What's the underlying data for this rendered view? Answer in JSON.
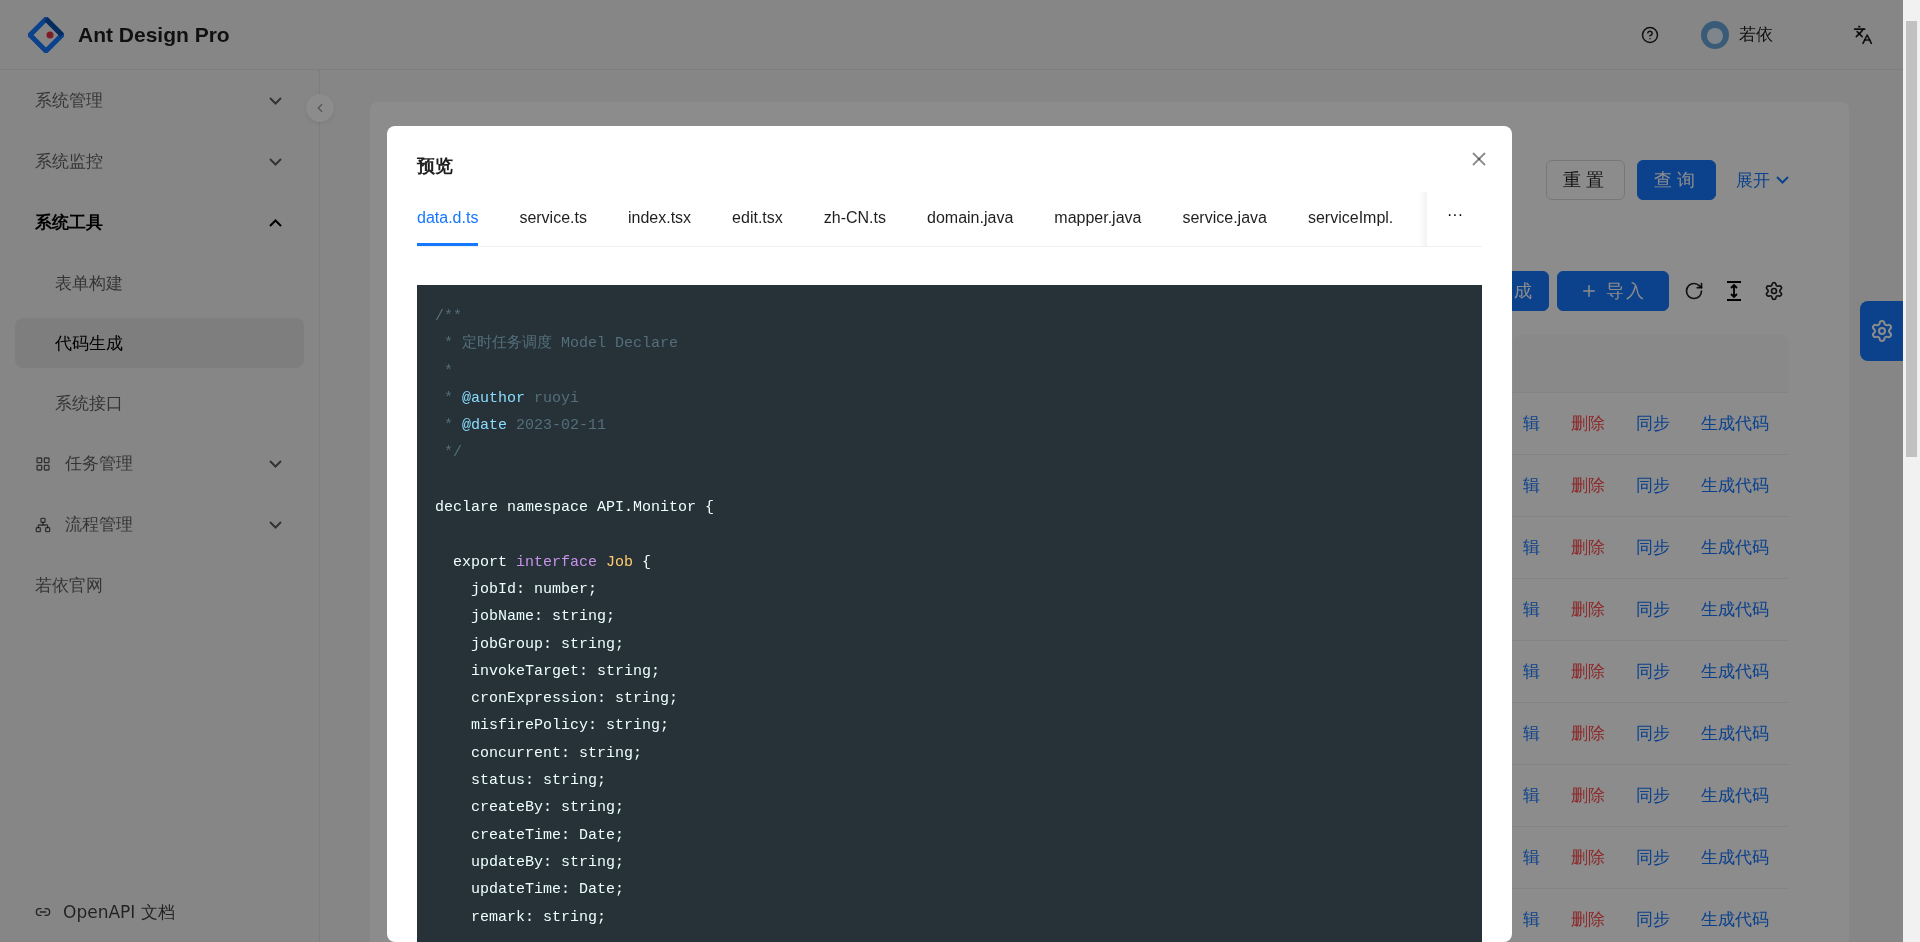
{
  "header": {
    "brand": "Ant Design Pro",
    "user": "若依"
  },
  "sidebar": {
    "items": [
      {
        "label": "系统管理",
        "kind": "plain",
        "expanded": false,
        "selected": false
      },
      {
        "label": "系统监控",
        "kind": "plain",
        "expanded": false,
        "selected": false
      },
      {
        "label": "系统工具",
        "kind": "plain",
        "expanded": true,
        "selected": true,
        "children": [
          {
            "label": "表单构建",
            "selected": false
          },
          {
            "label": "代码生成",
            "selected": true
          },
          {
            "label": "系统接口",
            "selected": false
          }
        ]
      },
      {
        "label": "任务管理",
        "kind": "grid",
        "expanded": false,
        "selected": false
      },
      {
        "label": "流程管理",
        "kind": "tree",
        "expanded": false,
        "selected": false
      },
      {
        "label": "若依官网",
        "kind": "leaf",
        "selected": false
      }
    ],
    "footer_link": "OpenAPI 文档"
  },
  "search": {
    "buttons": [
      {
        "label": "重置",
        "kind": "default"
      },
      {
        "label": "查询",
        "kind": "primary"
      }
    ],
    "expand_link": "展开"
  },
  "toolbar": {
    "buttons": [
      {
        "label": "成",
        "kind": "plain"
      },
      {
        "label": "导入",
        "kind": "plus"
      }
    ]
  },
  "table": {
    "rows": [
      {
        "actions": [
          {
            "text": "辑",
            "kind": "link"
          },
          {
            "text": "删除",
            "kind": "danger"
          },
          {
            "text": "同步",
            "kind": "link"
          },
          {
            "text": "生成代码",
            "kind": "link"
          }
        ]
      },
      {
        "actions": [
          {
            "text": "辑",
            "kind": "link"
          },
          {
            "text": "删除",
            "kind": "danger"
          },
          {
            "text": "同步",
            "kind": "link"
          },
          {
            "text": "生成代码",
            "kind": "link"
          }
        ]
      },
      {
        "actions": [
          {
            "text": "辑",
            "kind": "link"
          },
          {
            "text": "删除",
            "kind": "danger"
          },
          {
            "text": "同步",
            "kind": "link"
          },
          {
            "text": "生成代码",
            "kind": "link"
          }
        ]
      },
      {
        "actions": [
          {
            "text": "辑",
            "kind": "link"
          },
          {
            "text": "删除",
            "kind": "danger"
          },
          {
            "text": "同步",
            "kind": "link"
          },
          {
            "text": "生成代码",
            "kind": "link"
          }
        ]
      },
      {
        "actions": [
          {
            "text": "辑",
            "kind": "link"
          },
          {
            "text": "删除",
            "kind": "danger"
          },
          {
            "text": "同步",
            "kind": "link"
          },
          {
            "text": "生成代码",
            "kind": "link"
          }
        ]
      },
      {
        "actions": [
          {
            "text": "辑",
            "kind": "link"
          },
          {
            "text": "删除",
            "kind": "danger"
          },
          {
            "text": "同步",
            "kind": "link"
          },
          {
            "text": "生成代码",
            "kind": "link"
          }
        ]
      },
      {
        "actions": [
          {
            "text": "辑",
            "kind": "link"
          },
          {
            "text": "删除",
            "kind": "danger"
          },
          {
            "text": "同步",
            "kind": "link"
          },
          {
            "text": "生成代码",
            "kind": "link"
          }
        ]
      },
      {
        "actions": [
          {
            "text": "辑",
            "kind": "link"
          },
          {
            "text": "删除",
            "kind": "danger"
          },
          {
            "text": "同步",
            "kind": "link"
          },
          {
            "text": "生成代码",
            "kind": "link"
          }
        ]
      },
      {
        "actions": [
          {
            "text": "辑",
            "kind": "link"
          },
          {
            "text": "删除",
            "kind": "danger"
          },
          {
            "text": "同步",
            "kind": "link"
          },
          {
            "text": "生成代码",
            "kind": "link"
          }
        ]
      }
    ]
  },
  "modal": {
    "title": "预览",
    "tabs": [
      {
        "label": "data.d.ts",
        "selected": true
      },
      {
        "label": "service.ts",
        "selected": false
      },
      {
        "label": "index.tsx",
        "selected": false
      },
      {
        "label": "edit.tsx",
        "selected": false
      },
      {
        "label": "zh-CN.ts",
        "selected": false
      },
      {
        "label": "domain.java",
        "selected": false
      },
      {
        "label": "mapper.java",
        "selected": false
      },
      {
        "label": "service.java",
        "selected": false
      },
      {
        "label": "serviceImpl.",
        "selected": false
      }
    ],
    "more": "···",
    "code": [
      {
        "kind": "code",
        "tokens": [
          {
            "kind": "comment",
            "text": "/**"
          }
        ]
      },
      {
        "kind": "code",
        "tokens": [
          {
            "kind": "comment",
            "text": " * 定时任务调度 Model Declare"
          }
        ]
      },
      {
        "kind": "code",
        "tokens": [
          {
            "kind": "comment",
            "text": " *"
          }
        ]
      },
      {
        "kind": "code",
        "tokens": [
          {
            "kind": "comment",
            "text": " * "
          },
          {
            "kind": "tag",
            "text": "@author"
          },
          {
            "kind": "comment",
            "text": " ruoyi"
          }
        ]
      },
      {
        "kind": "code",
        "tokens": [
          {
            "kind": "comment",
            "text": " * "
          },
          {
            "kind": "tag",
            "text": "@date"
          },
          {
            "kind": "comment",
            "text": " 2023-02-11"
          }
        ]
      },
      {
        "kind": "code",
        "tokens": [
          {
            "kind": "comment",
            "text": " */"
          }
        ]
      },
      {
        "kind": "blank"
      },
      {
        "kind": "code",
        "tokens": [
          {
            "kind": "plain",
            "text": "declare namespace API.Monitor {"
          }
        ]
      },
      {
        "kind": "blank"
      },
      {
        "kind": "code",
        "tokens": [
          {
            "kind": "plain",
            "text": "  export "
          },
          {
            "kind": "keyword",
            "text": "interface"
          },
          {
            "kind": "type",
            "text": " Job"
          },
          {
            "kind": "plain",
            "text": " {"
          }
        ]
      },
      {
        "kind": "code",
        "tokens": [
          {
            "kind": "plain",
            "text": "    jobId: number;"
          }
        ]
      },
      {
        "kind": "code",
        "tokens": [
          {
            "kind": "plain",
            "text": "    jobName: string;"
          }
        ]
      },
      {
        "kind": "code",
        "tokens": [
          {
            "kind": "plain",
            "text": "    jobGroup: string;"
          }
        ]
      },
      {
        "kind": "code",
        "tokens": [
          {
            "kind": "plain",
            "text": "    invokeTarget: string;"
          }
        ]
      },
      {
        "kind": "code",
        "tokens": [
          {
            "kind": "plain",
            "text": "    cronExpression: string;"
          }
        ]
      },
      {
        "kind": "code",
        "tokens": [
          {
            "kind": "plain",
            "text": "    misfirePolicy: string;"
          }
        ]
      },
      {
        "kind": "code",
        "tokens": [
          {
            "kind": "plain",
            "text": "    concurrent: string;"
          }
        ]
      },
      {
        "kind": "code",
        "tokens": [
          {
            "kind": "plain",
            "text": "    status: string;"
          }
        ]
      },
      {
        "kind": "code",
        "tokens": [
          {
            "kind": "plain",
            "text": "    createBy: string;"
          }
        ]
      },
      {
        "kind": "code",
        "tokens": [
          {
            "kind": "plain",
            "text": "    createTime: Date;"
          }
        ]
      },
      {
        "kind": "code",
        "tokens": [
          {
            "kind": "plain",
            "text": "    updateBy: string;"
          }
        ]
      },
      {
        "kind": "code",
        "tokens": [
          {
            "kind": "plain",
            "text": "    updateTime: Date;"
          }
        ]
      },
      {
        "kind": "code",
        "tokens": [
          {
            "kind": "plain",
            "text": "    remark: string;"
          }
        ]
      }
    ]
  }
}
